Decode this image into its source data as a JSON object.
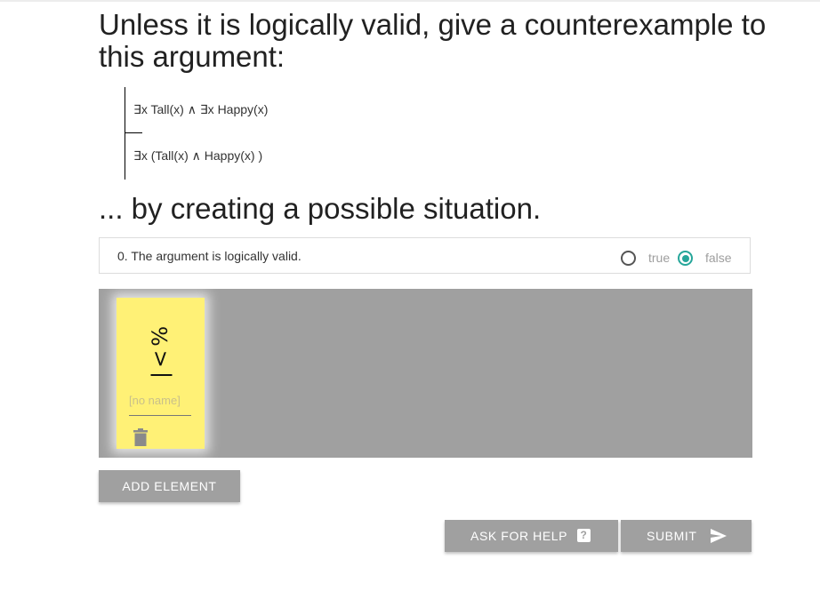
{
  "heading": "Unless it is logically valid, give a counterexample to this argument:",
  "argument": {
    "premise": "∃x Tall(x) ∧ ∃x Happy(x)",
    "conclusion": "∃x (Tall(x) ∧ Happy(x) )"
  },
  "subheading": "... by creating a possible situation.",
  "question": {
    "text": "0. The argument is logically valid.",
    "options": [
      "true",
      "false"
    ],
    "selected": "false"
  },
  "world": {
    "element": {
      "glyphs": "|<%",
      "name_placeholder": "[no name]",
      "name_value": ""
    }
  },
  "buttons": {
    "add_element": "ADD ELEMENT",
    "ask_for_help": "ASK FOR HELP",
    "submit": "SUBMIT"
  },
  "colors": {
    "accent": "#26a69a",
    "button_gray": "#a0a0a0",
    "element_yellow": "#fff176"
  },
  "icons": {
    "help": "help-box-icon",
    "submit": "send-icon",
    "delete": "trash-icon"
  }
}
